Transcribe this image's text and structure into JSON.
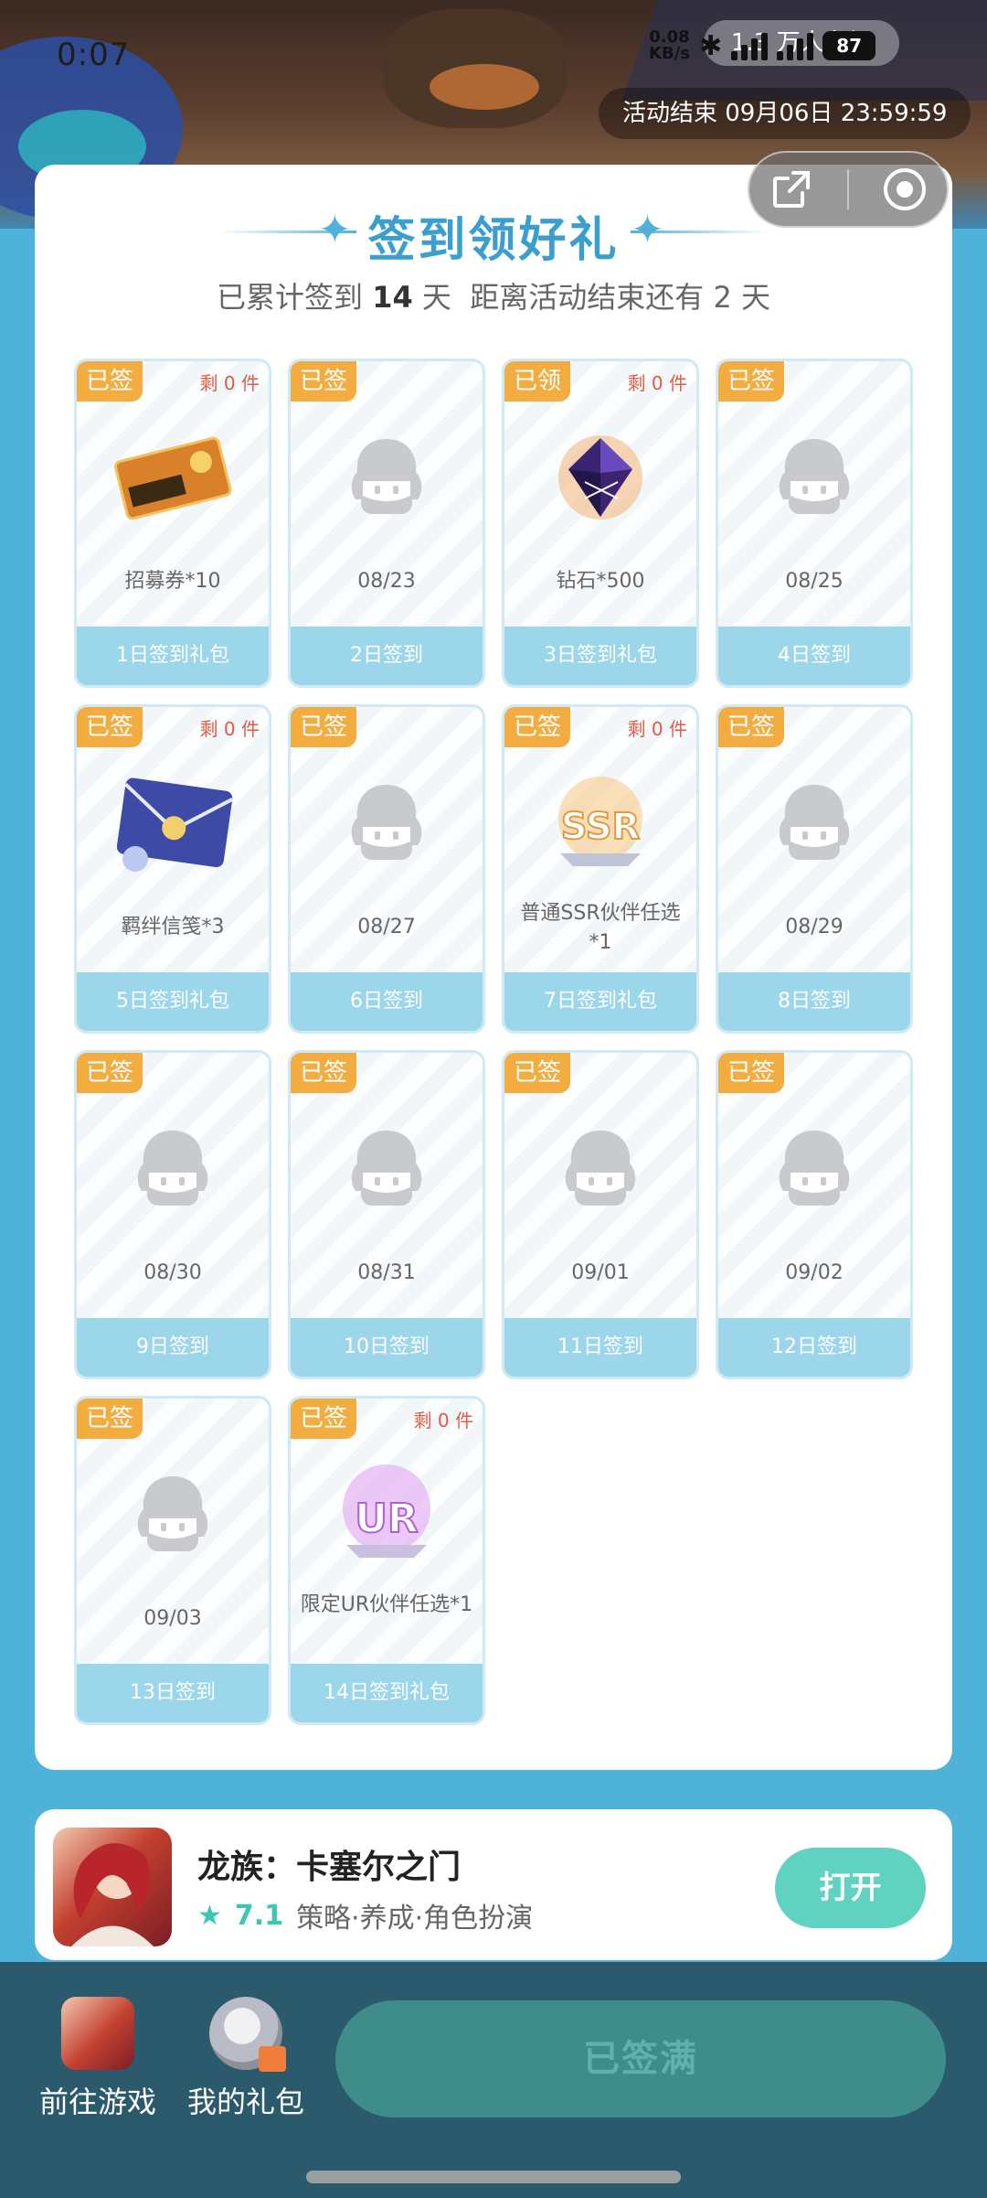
{
  "status_bar": {
    "time": "0:07",
    "speed_value": "0.08",
    "speed_unit": "KB/s",
    "battery": "87"
  },
  "header": {
    "joined_text": "1.3 万人参加",
    "activity_end": "活动结束 09月06日 23:59:59"
  },
  "panel": {
    "title": "签到领好礼",
    "subtitle_prefix": "已累计签到",
    "signed_days": "14",
    "subtitle_mid": "天  距离活动结束还有",
    "days_left": "2",
    "subtitle_suffix": "天"
  },
  "cards": [
    {
      "tag": "已签",
      "remain": "剩 0 件",
      "caption": "招募券*10",
      "footer": "1日签到礼包",
      "icon": "ticket-icon"
    },
    {
      "tag": "已签",
      "remain": "",
      "caption": "08/23",
      "footer": "2日签到",
      "icon": "placeholder-avatar-icon"
    },
    {
      "tag": "已领",
      "remain": "剩 0 件",
      "caption": "钻石*500",
      "footer": "3日签到礼包",
      "icon": "diamond-icon"
    },
    {
      "tag": "已签",
      "remain": "",
      "caption": "08/25",
      "footer": "4日签到",
      "icon": "placeholder-avatar-icon"
    },
    {
      "tag": "已签",
      "remain": "剩 0 件",
      "caption": "羁绊信笺*3",
      "footer": "5日签到礼包",
      "icon": "letter-icon"
    },
    {
      "tag": "已签",
      "remain": "",
      "caption": "08/27",
      "footer": "6日签到",
      "icon": "placeholder-avatar-icon"
    },
    {
      "tag": "已签",
      "remain": "剩 0 件",
      "caption": "普通SSR伙伴任选*1",
      "footer": "7日签到礼包",
      "icon": "ssr-icon"
    },
    {
      "tag": "已签",
      "remain": "",
      "caption": "08/29",
      "footer": "8日签到",
      "icon": "placeholder-avatar-icon"
    },
    {
      "tag": "已签",
      "remain": "",
      "caption": "08/30",
      "footer": "9日签到",
      "icon": "placeholder-avatar-icon"
    },
    {
      "tag": "已签",
      "remain": "",
      "caption": "08/31",
      "footer": "10日签到",
      "icon": "placeholder-avatar-icon"
    },
    {
      "tag": "已签",
      "remain": "",
      "caption": "09/01",
      "footer": "11日签到",
      "icon": "placeholder-avatar-icon"
    },
    {
      "tag": "已签",
      "remain": "",
      "caption": "09/02",
      "footer": "12日签到",
      "icon": "placeholder-avatar-icon"
    },
    {
      "tag": "已签",
      "remain": "",
      "caption": "09/03",
      "footer": "13日签到",
      "icon": "placeholder-avatar-icon"
    },
    {
      "tag": "已签",
      "remain": "剩 0 件",
      "caption": "限定UR伙伴任选*1",
      "footer": "14日签到礼包",
      "icon": "ur-icon"
    }
  ],
  "game": {
    "title": "龙族：卡塞尔之门",
    "score": "7.1",
    "tags": "策略·养成·角色扮演",
    "open_label": "打开"
  },
  "bottom": {
    "goto_game": "前往游戏",
    "my_gifts": "我的礼包",
    "main_button": "已签满"
  },
  "colors": {
    "background": "#4fb2d9",
    "tag": "#f3ac3f",
    "footer": "#9bd6ea",
    "title": "#3a9fcf",
    "open_button": "#5fd3c0",
    "bottom_bar": "#2a5a6c"
  }
}
